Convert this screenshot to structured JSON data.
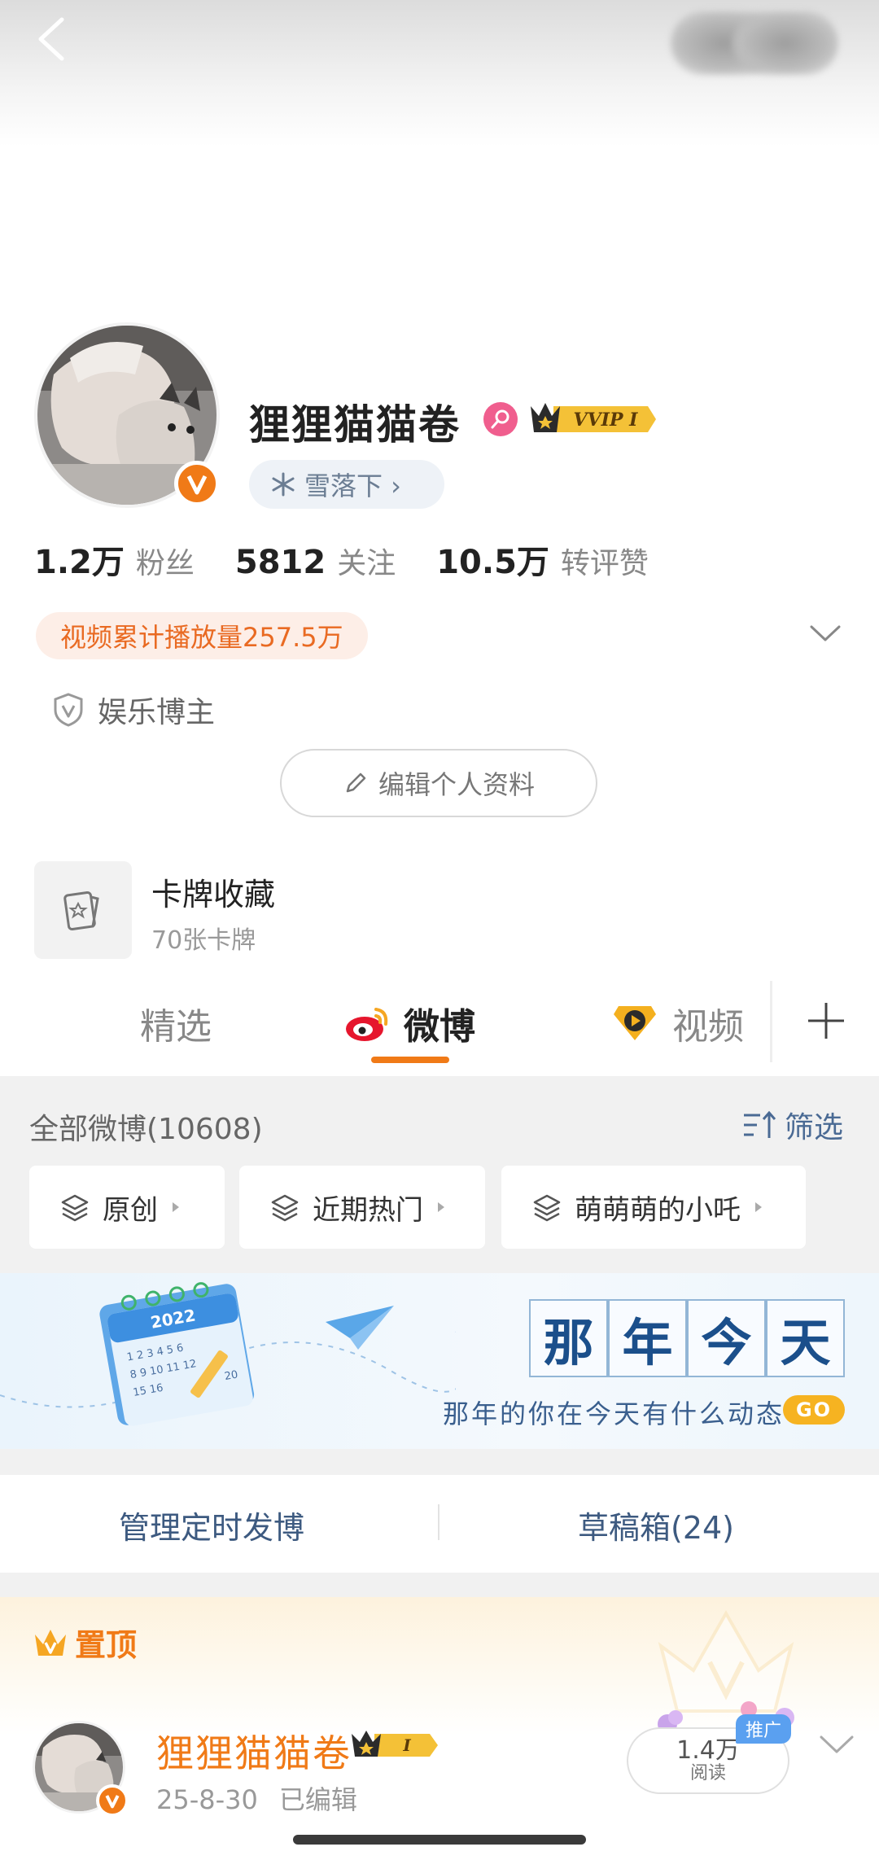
{
  "header": {
    "back_icon": "chevron-left-icon"
  },
  "profile": {
    "username": "狸狸猫猫卷",
    "vip_badge": "VVIP I",
    "snow_tag": "雪落下 ›",
    "stats": [
      {
        "value": "1.2万",
        "label": "粉丝"
      },
      {
        "value": "5812",
        "label": "关注"
      },
      {
        "value": "10.5万",
        "label": "转评赞"
      }
    ],
    "video_plays": "视频累计播放量257.5万",
    "category": "娱乐博主",
    "edit_button": "编辑个人资料",
    "card_collection": {
      "title": "卡牌收藏",
      "subtitle": "70张卡牌"
    }
  },
  "tabs": [
    {
      "label": "精选",
      "active": false
    },
    {
      "label": "微博",
      "active": true
    },
    {
      "label": "视频",
      "active": false
    }
  ],
  "feed": {
    "all_label": "全部微博(10608)",
    "filter_label": "筛选",
    "chips": [
      "原创",
      "近期热门",
      "萌萌萌的小吒"
    ]
  },
  "banner": {
    "calendar_year": "2022",
    "calendar_digits": [
      "1 2 3 4 5 6",
      "8 9 10 11 12",
      "15 16"
    ],
    "calendar_extra": "20",
    "title_chars": [
      "那",
      "年",
      "今",
      "天"
    ],
    "subtitle": "那年的你在今天有什么动态",
    "go_label": "GO"
  },
  "manage": {
    "scheduled": "管理定时发博",
    "drafts": "草稿箱(24)"
  },
  "pinned": {
    "label": "置顶",
    "author": "狸狸猫猫卷",
    "badge": "I",
    "date": "25-8-30",
    "edited": "已编辑",
    "reads_value": "1.4万",
    "reads_label": "阅读",
    "promo_label": "推广"
  },
  "colors": {
    "accent": "#f07a17",
    "link": "#3d5a80",
    "pink": "#f05e8e"
  }
}
